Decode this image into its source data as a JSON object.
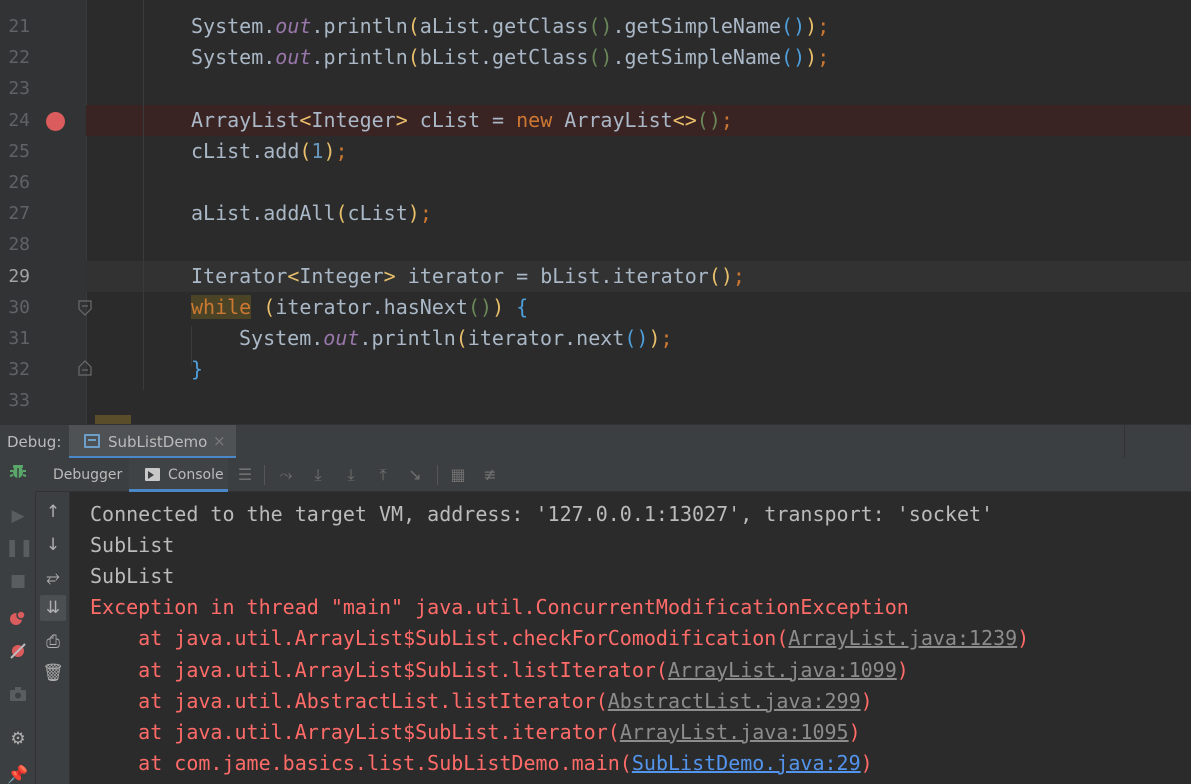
{
  "editor": {
    "lines": [
      {
        "num": "21",
        "segments": [
          [
            "",
            "System."
          ],
          [
            "fld",
            "out"
          ],
          [
            "",
            ".println"
          ],
          [
            "pa",
            "("
          ],
          [
            "",
            "aList.getClass"
          ],
          [
            "pb",
            "()"
          ],
          [
            "",
            ".getSimpleName"
          ],
          [
            "pc",
            "()"
          ],
          [
            "pa",
            ")"
          ],
          [
            "kw",
            ";"
          ]
        ]
      },
      {
        "num": "22",
        "segments": [
          [
            "",
            "System."
          ],
          [
            "fld",
            "out"
          ],
          [
            "",
            ".println"
          ],
          [
            "pa",
            "("
          ],
          [
            "",
            "bList.getClass"
          ],
          [
            "pb",
            "()"
          ],
          [
            "",
            ".getSimpleName"
          ],
          [
            "pc",
            "()"
          ],
          [
            "pa",
            ")"
          ],
          [
            "kw",
            ";"
          ]
        ]
      },
      {
        "num": "23",
        "segments": []
      },
      {
        "num": "24",
        "breakpoint": true,
        "segments": [
          [
            "",
            "ArrayList"
          ],
          [
            "pa",
            "<"
          ],
          [
            "",
            "Integer"
          ],
          [
            "pa",
            ">"
          ],
          [
            "",
            " cList = "
          ],
          [
            "kw",
            "new"
          ],
          [
            "",
            " ArrayList"
          ],
          [
            "pa",
            "<>"
          ],
          [
            "pb",
            "()"
          ],
          [
            "kw",
            ";"
          ]
        ]
      },
      {
        "num": "25",
        "segments": [
          [
            "",
            "cList.add"
          ],
          [
            "pa",
            "("
          ],
          [
            "num",
            "1"
          ],
          [
            "pa",
            ")"
          ],
          [
            "kw",
            ";"
          ]
        ]
      },
      {
        "num": "26",
        "segments": []
      },
      {
        "num": "27",
        "segments": [
          [
            "",
            "aList.addAll"
          ],
          [
            "pa",
            "("
          ],
          [
            "",
            "cList"
          ],
          [
            "pa",
            ")"
          ],
          [
            "kw",
            ";"
          ]
        ]
      },
      {
        "num": "28",
        "segments": []
      },
      {
        "num": "29",
        "caret": true,
        "segments": [
          [
            "",
            "Iterator"
          ],
          [
            "pa",
            "<"
          ],
          [
            "",
            "Integer"
          ],
          [
            "pa",
            ">"
          ],
          [
            "",
            " iterator = bList.iterator"
          ],
          [
            "pa",
            "()"
          ],
          [
            "kw",
            ";"
          ]
        ]
      },
      {
        "num": "30",
        "fold": "open",
        "segments": [
          [
            "kw while-hl",
            "while"
          ],
          [
            "",
            " "
          ],
          [
            "pa",
            "("
          ],
          [
            "",
            "iterator.hasNext"
          ],
          [
            "pb",
            "()"
          ],
          [
            "pa",
            ")"
          ],
          [
            "",
            " "
          ],
          [
            "pc",
            "{"
          ]
        ]
      },
      {
        "num": "31",
        "indent": 1,
        "segments": [
          [
            "",
            "System."
          ],
          [
            "fld",
            "out"
          ],
          [
            "",
            ".println"
          ],
          [
            "pa",
            "("
          ],
          [
            "",
            "iterator.next"
          ],
          [
            "pc",
            "()"
          ],
          [
            "pa",
            ")"
          ],
          [
            "kw",
            ";"
          ]
        ]
      },
      {
        "num": "32",
        "fold": "close",
        "segments": [
          [
            "pc",
            "}"
          ]
        ]
      },
      {
        "num": "33",
        "segments": []
      }
    ]
  },
  "debug": {
    "label": "Debug:",
    "tab_title": "SubListDemo",
    "tab_close": "×"
  },
  "toolbar": {
    "debugger_label": "Debugger",
    "console_label": "Console"
  },
  "console": {
    "lines": [
      {
        "kind": "info",
        "text": "Connected to the target VM, address: '127.0.0.1:13027', transport: 'socket'"
      },
      {
        "kind": "info",
        "text": "SubList"
      },
      {
        "kind": "info",
        "text": "SubList"
      },
      {
        "kind": "err",
        "text": "Exception in thread \"main\" java.util.ConcurrentModificationException"
      },
      {
        "kind": "err",
        "prefix": "    at java.util.ArrayList$SubList.checkForComodification(",
        "link": "ArrayList.java:1239",
        "suffix": ")"
      },
      {
        "kind": "err",
        "prefix": "    at java.util.ArrayList$SubList.listIterator(",
        "link": "ArrayList.java:1099",
        "suffix": ")"
      },
      {
        "kind": "err",
        "prefix": "    at java.util.AbstractList.listIterator(",
        "link": "AbstractList.java:299",
        "suffix": ")"
      },
      {
        "kind": "err",
        "prefix": "    at java.util.ArrayList$SubList.iterator(",
        "link": "ArrayList.java:1095",
        "suffix": ")"
      },
      {
        "kind": "err",
        "prefix": "    at com.jame.basics.list.SubListDemo.main(",
        "link": "SubListDemo.java:29",
        "suffix": ")",
        "link_blue": true
      }
    ]
  },
  "colors": {
    "error": "#ff6b68",
    "keyword": "#cc7832",
    "breakpoint": "#db5c5c",
    "accent": "#4a88c7"
  },
  "icons": {
    "left_strip": [
      "debug-bug-icon",
      "resume-icon",
      "pause-icon",
      "stop-icon",
      "view-breakpoints-icon",
      "mute-breakpoints-icon",
      "camera-icon",
      "settings-icon",
      "pin-icon"
    ],
    "side_strip": [
      "up-arrow-icon",
      "down-arrow-icon",
      "soft-wrap-icon",
      "scroll-to-end-icon",
      "print-icon",
      "trash-icon"
    ]
  }
}
